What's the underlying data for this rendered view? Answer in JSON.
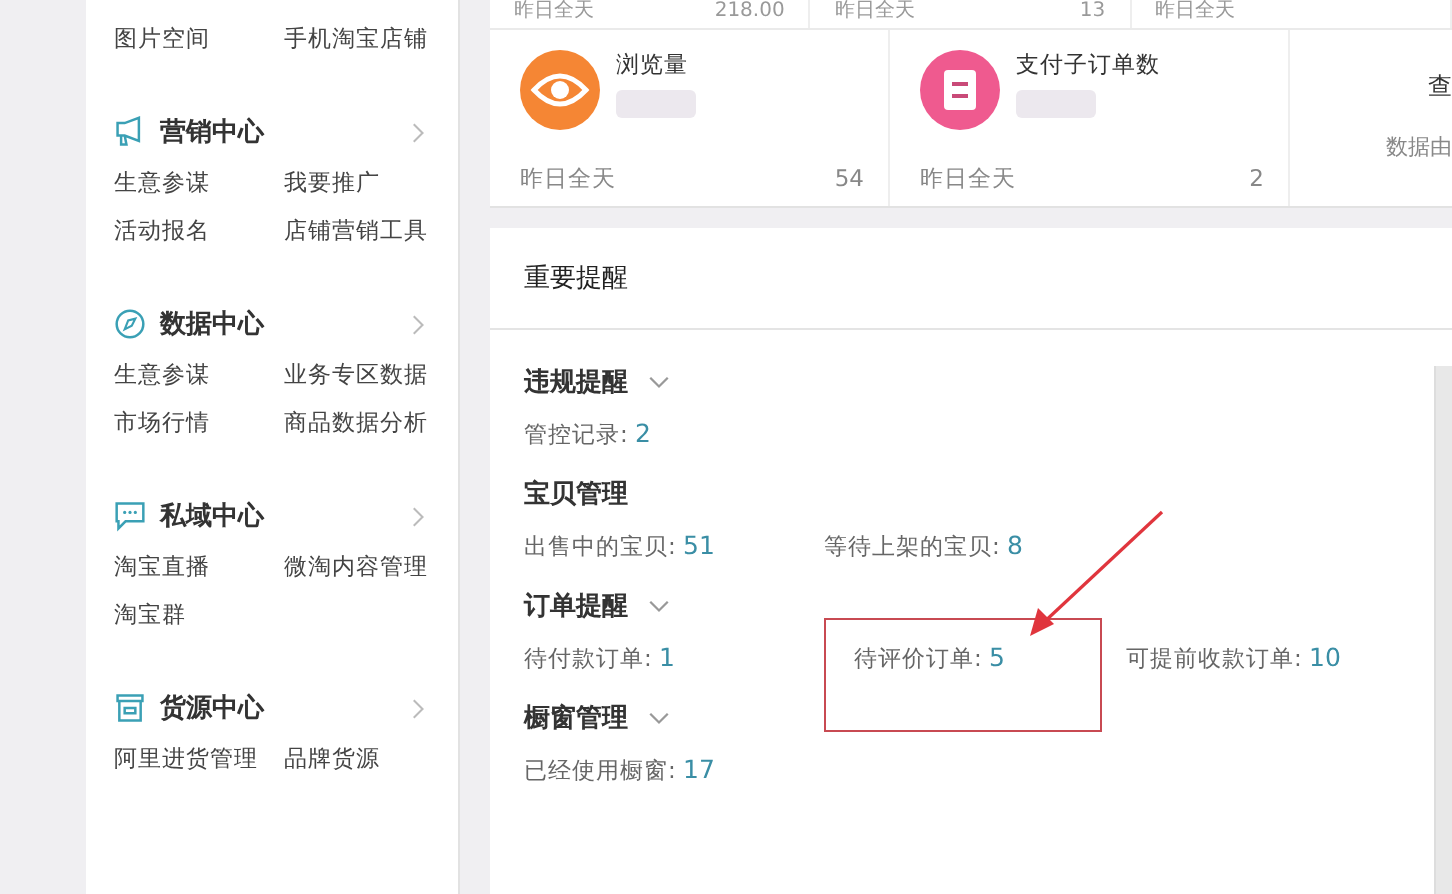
{
  "sidebar": {
    "top_links": [
      "图片空间",
      "手机淘宝店铺"
    ],
    "sections": [
      {
        "title": "营销中心",
        "links": [
          "生意参谋",
          "我要推广",
          "活动报名",
          "店铺营销工具"
        ]
      },
      {
        "title": "数据中心",
        "links": [
          "生意参谋",
          "业务专区数据",
          "市场行情",
          "商品数据分析"
        ]
      },
      {
        "title": "私域中心",
        "links": [
          "淘宝直播",
          "微淘内容管理",
          "淘宝群"
        ]
      },
      {
        "title": "货源中心",
        "links": [
          "阿里进货管理",
          "品牌货源"
        ]
      }
    ]
  },
  "stats_top": [
    {
      "period": "昨日全天",
      "value": "218.00"
    },
    {
      "period": "昨日全天",
      "value": "13"
    },
    {
      "period": "昨日全天"
    }
  ],
  "stats": [
    {
      "color": "#f58634",
      "label": "浏览量",
      "period": "昨日全天",
      "value": "54"
    },
    {
      "color": "#ef5a8f",
      "label": "支付子订单数",
      "period": "昨日全天",
      "value": "2"
    }
  ],
  "more_card": {
    "label": "查",
    "note": "数据由"
  },
  "reminders": {
    "title": "重要提醒",
    "groups": [
      {
        "title": "违规提醒",
        "expandable": true,
        "items": [
          {
            "label": "管控记录:",
            "count": "2",
            "highlighted": false
          }
        ]
      },
      {
        "title": "宝贝管理",
        "expandable": false,
        "items": [
          {
            "label": "出售中的宝贝:",
            "count": "51",
            "highlighted": false
          },
          {
            "label": "等待上架的宝贝:",
            "count": "8",
            "highlighted": false
          }
        ]
      },
      {
        "title": "订单提醒",
        "expandable": true,
        "items": [
          {
            "label": "待付款订单:",
            "count": "1",
            "highlighted": false
          },
          {
            "label": "待评价订单:",
            "count": "5",
            "highlighted": true
          },
          {
            "label": "可提前收款订单:",
            "count": "10",
            "highlighted": false
          }
        ]
      },
      {
        "title": "橱窗管理",
        "expandable": true,
        "items": [
          {
            "label": "已经使用橱窗:",
            "count": "17",
            "highlighted": false
          }
        ]
      }
    ]
  }
}
